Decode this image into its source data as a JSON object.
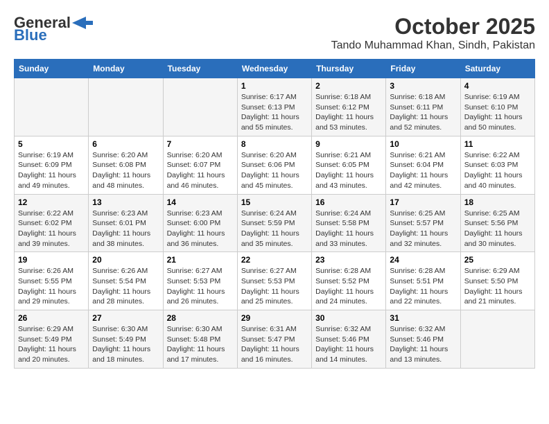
{
  "header": {
    "logo_general": "General",
    "logo_blue": "Blue",
    "title": "October 2025",
    "subtitle": "Tando Muhammad Khan, Sindh, Pakistan"
  },
  "days_of_week": [
    "Sunday",
    "Monday",
    "Tuesday",
    "Wednesday",
    "Thursday",
    "Friday",
    "Saturday"
  ],
  "weeks": [
    [
      {
        "day": "",
        "info": ""
      },
      {
        "day": "",
        "info": ""
      },
      {
        "day": "",
        "info": ""
      },
      {
        "day": "1",
        "info": "Sunrise: 6:17 AM\nSunset: 6:13 PM\nDaylight: 11 hours and 55 minutes."
      },
      {
        "day": "2",
        "info": "Sunrise: 6:18 AM\nSunset: 6:12 PM\nDaylight: 11 hours and 53 minutes."
      },
      {
        "day": "3",
        "info": "Sunrise: 6:18 AM\nSunset: 6:11 PM\nDaylight: 11 hours and 52 minutes."
      },
      {
        "day": "4",
        "info": "Sunrise: 6:19 AM\nSunset: 6:10 PM\nDaylight: 11 hours and 50 minutes."
      }
    ],
    [
      {
        "day": "5",
        "info": "Sunrise: 6:19 AM\nSunset: 6:09 PM\nDaylight: 11 hours and 49 minutes."
      },
      {
        "day": "6",
        "info": "Sunrise: 6:20 AM\nSunset: 6:08 PM\nDaylight: 11 hours and 48 minutes."
      },
      {
        "day": "7",
        "info": "Sunrise: 6:20 AM\nSunset: 6:07 PM\nDaylight: 11 hours and 46 minutes."
      },
      {
        "day": "8",
        "info": "Sunrise: 6:20 AM\nSunset: 6:06 PM\nDaylight: 11 hours and 45 minutes."
      },
      {
        "day": "9",
        "info": "Sunrise: 6:21 AM\nSunset: 6:05 PM\nDaylight: 11 hours and 43 minutes."
      },
      {
        "day": "10",
        "info": "Sunrise: 6:21 AM\nSunset: 6:04 PM\nDaylight: 11 hours and 42 minutes."
      },
      {
        "day": "11",
        "info": "Sunrise: 6:22 AM\nSunset: 6:03 PM\nDaylight: 11 hours and 40 minutes."
      }
    ],
    [
      {
        "day": "12",
        "info": "Sunrise: 6:22 AM\nSunset: 6:02 PM\nDaylight: 11 hours and 39 minutes."
      },
      {
        "day": "13",
        "info": "Sunrise: 6:23 AM\nSunset: 6:01 PM\nDaylight: 11 hours and 38 minutes."
      },
      {
        "day": "14",
        "info": "Sunrise: 6:23 AM\nSunset: 6:00 PM\nDaylight: 11 hours and 36 minutes."
      },
      {
        "day": "15",
        "info": "Sunrise: 6:24 AM\nSunset: 5:59 PM\nDaylight: 11 hours and 35 minutes."
      },
      {
        "day": "16",
        "info": "Sunrise: 6:24 AM\nSunset: 5:58 PM\nDaylight: 11 hours and 33 minutes."
      },
      {
        "day": "17",
        "info": "Sunrise: 6:25 AM\nSunset: 5:57 PM\nDaylight: 11 hours and 32 minutes."
      },
      {
        "day": "18",
        "info": "Sunrise: 6:25 AM\nSunset: 5:56 PM\nDaylight: 11 hours and 30 minutes."
      }
    ],
    [
      {
        "day": "19",
        "info": "Sunrise: 6:26 AM\nSunset: 5:55 PM\nDaylight: 11 hours and 29 minutes."
      },
      {
        "day": "20",
        "info": "Sunrise: 6:26 AM\nSunset: 5:54 PM\nDaylight: 11 hours and 28 minutes."
      },
      {
        "day": "21",
        "info": "Sunrise: 6:27 AM\nSunset: 5:53 PM\nDaylight: 11 hours and 26 minutes."
      },
      {
        "day": "22",
        "info": "Sunrise: 6:27 AM\nSunset: 5:53 PM\nDaylight: 11 hours and 25 minutes."
      },
      {
        "day": "23",
        "info": "Sunrise: 6:28 AM\nSunset: 5:52 PM\nDaylight: 11 hours and 24 minutes."
      },
      {
        "day": "24",
        "info": "Sunrise: 6:28 AM\nSunset: 5:51 PM\nDaylight: 11 hours and 22 minutes."
      },
      {
        "day": "25",
        "info": "Sunrise: 6:29 AM\nSunset: 5:50 PM\nDaylight: 11 hours and 21 minutes."
      }
    ],
    [
      {
        "day": "26",
        "info": "Sunrise: 6:29 AM\nSunset: 5:49 PM\nDaylight: 11 hours and 20 minutes."
      },
      {
        "day": "27",
        "info": "Sunrise: 6:30 AM\nSunset: 5:49 PM\nDaylight: 11 hours and 18 minutes."
      },
      {
        "day": "28",
        "info": "Sunrise: 6:30 AM\nSunset: 5:48 PM\nDaylight: 11 hours and 17 minutes."
      },
      {
        "day": "29",
        "info": "Sunrise: 6:31 AM\nSunset: 5:47 PM\nDaylight: 11 hours and 16 minutes."
      },
      {
        "day": "30",
        "info": "Sunrise: 6:32 AM\nSunset: 5:46 PM\nDaylight: 11 hours and 14 minutes."
      },
      {
        "day": "31",
        "info": "Sunrise: 6:32 AM\nSunset: 5:46 PM\nDaylight: 11 hours and 13 minutes."
      },
      {
        "day": "",
        "info": ""
      }
    ]
  ]
}
